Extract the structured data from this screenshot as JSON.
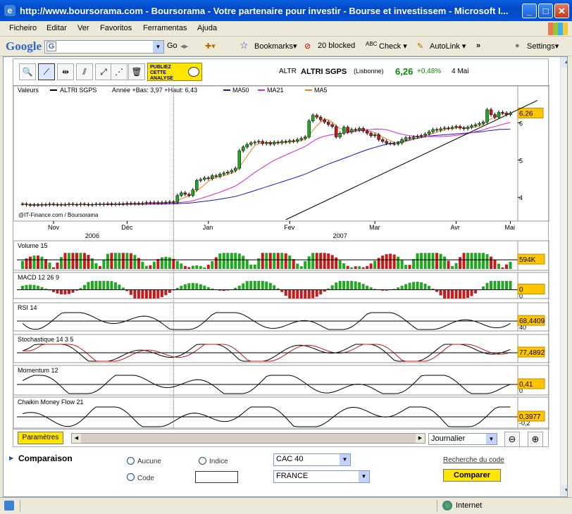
{
  "window": {
    "title": "http://www.boursorama.com - Boursorama - Votre partenaire pour investir - Bourse et investissem - Microsoft I...",
    "buttons": {
      "minimize": "_",
      "maximize": "□",
      "close": "✕"
    }
  },
  "menu": [
    "Ficheiro",
    "Editar",
    "Ver",
    "Favoritos",
    "Ferramentas",
    "Ajuda"
  ],
  "google_toolbar": {
    "logo": "Google",
    "go": "Go",
    "bookmarks": "Bookmarks",
    "blocked": "20 blocked",
    "check": "Check",
    "autolink": "AutoLink",
    "more": "»",
    "settings": "Settings"
  },
  "chart_header": {
    "ad_text": "PUBLIEZ CETTE ANALYSE",
    "symbol": "ALTR",
    "name": "ALTRI SGPS",
    "market": "(Lisbonne)",
    "price": "6,26",
    "change": "+0,48%",
    "date": "4 Mai"
  },
  "colors": {
    "up": "#21a821",
    "down": "#c81a1a",
    "ma50": "#1818c8",
    "ma21": "#e01ee0",
    "ma5": "#f07c1c",
    "value_box": "#ffc600",
    "accent_yellow": "#ffe600",
    "price_green": "#0b8a0b"
  },
  "chart_data": [
    {
      "type": "candlestick",
      "title": "Valeurs",
      "series_label": "ALTRI SGPS",
      "range_label": "Année +Bas: 3,97 +Haut: 6,43",
      "legend": [
        "MA50",
        "MA21",
        "MA5"
      ],
      "credit": "@IT-Finance.com / Boursorama",
      "x_ticks": [
        "Nov",
        "Déc",
        "Jan",
        "Fev",
        "Mar",
        "Avr",
        "Mai"
      ],
      "years": [
        "2006",
        "2007"
      ],
      "y_ticks": [
        4,
        5,
        6
      ],
      "ylim": [
        3.4,
        6.8
      ],
      "last_value": "6,26",
      "close": [
        3.82,
        3.8,
        3.79,
        3.8,
        3.79,
        3.81,
        3.8,
        3.82,
        3.81,
        3.8,
        3.81,
        3.8,
        3.82,
        3.81,
        3.8,
        3.82,
        3.81,
        3.8,
        3.81,
        3.82,
        3.81,
        3.82,
        3.83,
        3.81,
        3.82,
        3.83,
        3.82,
        3.84,
        3.83,
        3.84,
        3.83,
        3.84,
        3.86,
        3.85,
        3.86,
        3.85,
        3.86,
        3.87,
        3.88,
        3.87,
        4.05,
        4.12,
        4.08,
        4.05,
        4.2,
        4.45,
        4.48,
        4.52,
        4.5,
        4.58,
        4.56,
        4.62,
        4.65,
        4.68,
        4.72,
        4.78,
        5.25,
        5.35,
        5.42,
        5.46,
        5.48,
        5.5,
        5.44,
        5.47,
        5.43,
        5.48,
        5.46,
        5.5,
        5.48,
        5.52,
        5.5,
        5.55,
        5.58,
        5.62,
        6.05,
        6.2,
        6.15,
        6.08,
        6.02,
        5.95,
        5.9,
        5.62,
        5.72,
        5.88,
        5.75,
        5.82,
        5.8,
        5.85,
        5.78,
        5.72,
        5.65,
        5.68,
        5.55,
        5.5,
        5.45,
        5.44,
        5.43,
        5.46,
        5.55,
        5.6,
        5.58,
        5.62,
        5.64,
        5.66,
        5.7,
        5.76,
        5.82,
        5.8,
        5.84,
        5.86,
        5.85,
        5.88,
        5.9,
        5.86,
        5.84,
        5.88,
        5.92,
        5.95,
        5.98,
        6.02,
        6.35,
        6.22,
        6.15,
        6.28,
        6.26,
        6.22,
        6.26
      ]
    },
    {
      "type": "bar",
      "title": "Volume 15",
      "last_value": "594K"
    },
    {
      "type": "bar",
      "title": "MACD 12 26 9",
      "y_ticks": [
        0
      ],
      "last_value": "0"
    },
    {
      "type": "line",
      "title": "RSI 14",
      "y_ticks": [
        40
      ],
      "last_value": "68,4409"
    },
    {
      "type": "line",
      "title": "Stochastique 14 3 5",
      "last_value": "77,4892"
    },
    {
      "type": "line",
      "title": "Momentum 12",
      "y_ticks": [
        0
      ],
      "last_value": "0,41"
    },
    {
      "type": "line",
      "title": "Chaikin Money Flow 21",
      "y_ticks": [
        "-0,2"
      ],
      "last_value": "0,3977"
    }
  ],
  "chart_footer": {
    "params": "Paramètres",
    "period": "Journalier"
  },
  "comparison": {
    "title": "Comparaison",
    "options": [
      "Aucune",
      "Indice",
      "Code"
    ],
    "index_select": "CAC 40",
    "country_select": "FRANCE",
    "search_link": "Recherche du code",
    "compare_button": "Comparer"
  },
  "statusbar": {
    "zone": "Internet"
  }
}
